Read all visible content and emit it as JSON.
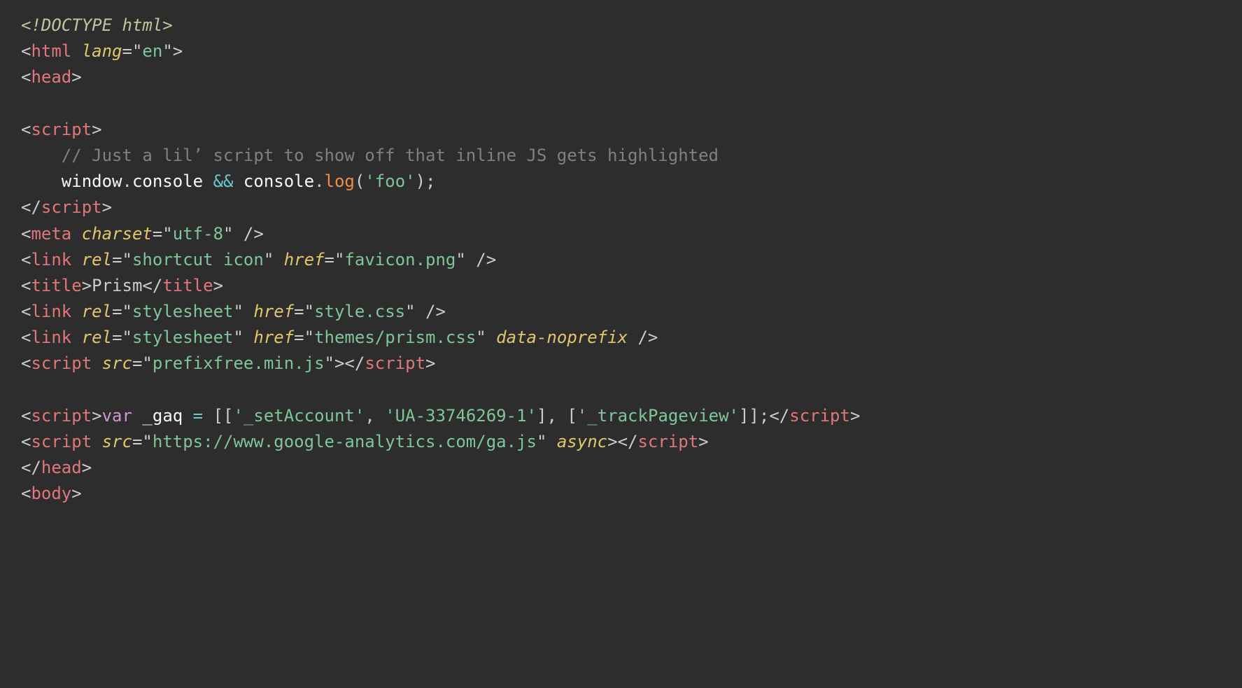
{
  "tokens": [
    [
      {
        "t": "<!DOCTYPE html>",
        "c": "doctype"
      }
    ],
    [
      {
        "t": "<",
        "c": "punct"
      },
      {
        "t": "html",
        "c": "tag"
      },
      {
        "t": " ",
        "c": "plain"
      },
      {
        "t": "lang",
        "c": "attr-name"
      },
      {
        "t": "=\"",
        "c": "punct"
      },
      {
        "t": "en",
        "c": "attr-val"
      },
      {
        "t": "\">",
        "c": "punct"
      }
    ],
    [
      {
        "t": "<",
        "c": "punct"
      },
      {
        "t": "head",
        "c": "tag"
      },
      {
        "t": ">",
        "c": "punct"
      }
    ],
    [],
    [
      {
        "t": "<",
        "c": "punct"
      },
      {
        "t": "script",
        "c": "tag"
      },
      {
        "t": ">",
        "c": "punct"
      }
    ],
    [
      {
        "t": "    ",
        "c": "plain"
      },
      {
        "t": "// Just a lil’ script to show off that inline JS gets highlighted",
        "c": "comment"
      }
    ],
    [
      {
        "t": "    ",
        "c": "plain"
      },
      {
        "t": "window",
        "c": "obj"
      },
      {
        "t": ".",
        "c": "punct"
      },
      {
        "t": "console",
        "c": "obj"
      },
      {
        "t": " ",
        "c": "plain"
      },
      {
        "t": "&&",
        "c": "operator"
      },
      {
        "t": " ",
        "c": "plain"
      },
      {
        "t": "console",
        "c": "obj"
      },
      {
        "t": ".",
        "c": "punct"
      },
      {
        "t": "log",
        "c": "func"
      },
      {
        "t": "(",
        "c": "punct"
      },
      {
        "t": "'foo'",
        "c": "string"
      },
      {
        "t": ")",
        "c": "punct"
      },
      {
        "t": ";",
        "c": "punct"
      }
    ],
    [
      {
        "t": "</",
        "c": "punct"
      },
      {
        "t": "script",
        "c": "tag"
      },
      {
        "t": ">",
        "c": "punct"
      }
    ],
    [
      {
        "t": "<",
        "c": "punct"
      },
      {
        "t": "meta",
        "c": "tag"
      },
      {
        "t": " ",
        "c": "plain"
      },
      {
        "t": "charset",
        "c": "attr-name"
      },
      {
        "t": "=\"",
        "c": "punct"
      },
      {
        "t": "utf-8",
        "c": "attr-val"
      },
      {
        "t": "\"",
        "c": "punct"
      },
      {
        "t": " />",
        "c": "punct"
      }
    ],
    [
      {
        "t": "<",
        "c": "punct"
      },
      {
        "t": "link",
        "c": "tag"
      },
      {
        "t": " ",
        "c": "plain"
      },
      {
        "t": "rel",
        "c": "attr-name"
      },
      {
        "t": "=\"",
        "c": "punct"
      },
      {
        "t": "shortcut icon",
        "c": "attr-val"
      },
      {
        "t": "\"",
        "c": "punct"
      },
      {
        "t": " ",
        "c": "plain"
      },
      {
        "t": "href",
        "c": "attr-name"
      },
      {
        "t": "=\"",
        "c": "punct"
      },
      {
        "t": "favicon.png",
        "c": "attr-val"
      },
      {
        "t": "\"",
        "c": "punct"
      },
      {
        "t": " />",
        "c": "punct"
      }
    ],
    [
      {
        "t": "<",
        "c": "punct"
      },
      {
        "t": "title",
        "c": "tag"
      },
      {
        "t": ">",
        "c": "punct"
      },
      {
        "t": "Prism",
        "c": "plain"
      },
      {
        "t": "</",
        "c": "punct"
      },
      {
        "t": "title",
        "c": "tag"
      },
      {
        "t": ">",
        "c": "punct"
      }
    ],
    [
      {
        "t": "<",
        "c": "punct"
      },
      {
        "t": "link",
        "c": "tag"
      },
      {
        "t": " ",
        "c": "plain"
      },
      {
        "t": "rel",
        "c": "attr-name"
      },
      {
        "t": "=\"",
        "c": "punct"
      },
      {
        "t": "stylesheet",
        "c": "attr-val"
      },
      {
        "t": "\"",
        "c": "punct"
      },
      {
        "t": " ",
        "c": "plain"
      },
      {
        "t": "href",
        "c": "attr-name"
      },
      {
        "t": "=\"",
        "c": "punct"
      },
      {
        "t": "style.css",
        "c": "attr-val"
      },
      {
        "t": "\"",
        "c": "punct"
      },
      {
        "t": " />",
        "c": "punct"
      }
    ],
    [
      {
        "t": "<",
        "c": "punct"
      },
      {
        "t": "link",
        "c": "tag"
      },
      {
        "t": " ",
        "c": "plain"
      },
      {
        "t": "rel",
        "c": "attr-name"
      },
      {
        "t": "=\"",
        "c": "punct"
      },
      {
        "t": "stylesheet",
        "c": "attr-val"
      },
      {
        "t": "\"",
        "c": "punct"
      },
      {
        "t": " ",
        "c": "plain"
      },
      {
        "t": "href",
        "c": "attr-name"
      },
      {
        "t": "=\"",
        "c": "punct"
      },
      {
        "t": "themes/prism.css",
        "c": "attr-val"
      },
      {
        "t": "\"",
        "c": "punct"
      },
      {
        "t": " ",
        "c": "plain"
      },
      {
        "t": "data-noprefix",
        "c": "attr-name"
      },
      {
        "t": " />",
        "c": "punct"
      }
    ],
    [
      {
        "t": "<",
        "c": "punct"
      },
      {
        "t": "script",
        "c": "tag"
      },
      {
        "t": " ",
        "c": "plain"
      },
      {
        "t": "src",
        "c": "attr-name"
      },
      {
        "t": "=\"",
        "c": "punct"
      },
      {
        "t": "prefixfree.min.js",
        "c": "attr-val"
      },
      {
        "t": "\">",
        "c": "punct"
      },
      {
        "t": "</",
        "c": "punct"
      },
      {
        "t": "script",
        "c": "tag"
      },
      {
        "t": ">",
        "c": "punct"
      }
    ],
    [],
    [
      {
        "t": "<",
        "c": "punct"
      },
      {
        "t": "script",
        "c": "tag"
      },
      {
        "t": ">",
        "c": "punct"
      },
      {
        "t": "var",
        "c": "kw-decl"
      },
      {
        "t": " ",
        "c": "plain"
      },
      {
        "t": "_gaq",
        "c": "variable"
      },
      {
        "t": " ",
        "c": "plain"
      },
      {
        "t": "=",
        "c": "operator"
      },
      {
        "t": " ",
        "c": "plain"
      },
      {
        "t": "[[",
        "c": "punct"
      },
      {
        "t": "'_setAccount'",
        "c": "string"
      },
      {
        "t": ",",
        "c": "punct"
      },
      {
        "t": " ",
        "c": "plain"
      },
      {
        "t": "'UA-33746269-1'",
        "c": "string"
      },
      {
        "t": "]",
        "c": "punct"
      },
      {
        "t": ",",
        "c": "punct"
      },
      {
        "t": " ",
        "c": "plain"
      },
      {
        "t": "[",
        "c": "punct"
      },
      {
        "t": "'_trackPageview'",
        "c": "string"
      },
      {
        "t": "]]",
        "c": "punct"
      },
      {
        "t": ";",
        "c": "punct"
      },
      {
        "t": "</",
        "c": "punct"
      },
      {
        "t": "script",
        "c": "tag"
      },
      {
        "t": ">",
        "c": "punct"
      }
    ],
    [
      {
        "t": "<",
        "c": "punct"
      },
      {
        "t": "script",
        "c": "tag"
      },
      {
        "t": " ",
        "c": "plain"
      },
      {
        "t": "src",
        "c": "attr-name"
      },
      {
        "t": "=\"",
        "c": "punct"
      },
      {
        "t": "https://www.google-analytics.com/ga.js",
        "c": "attr-val"
      },
      {
        "t": "\"",
        "c": "punct"
      },
      {
        "t": " ",
        "c": "plain"
      },
      {
        "t": "async",
        "c": "attr-name"
      },
      {
        "t": ">",
        "c": "punct"
      },
      {
        "t": "</",
        "c": "punct"
      },
      {
        "t": "script",
        "c": "tag"
      },
      {
        "t": ">",
        "c": "punct"
      }
    ],
    [
      {
        "t": "</",
        "c": "punct"
      },
      {
        "t": "head",
        "c": "tag"
      },
      {
        "t": ">",
        "c": "punct"
      }
    ],
    [
      {
        "t": "<",
        "c": "punct"
      },
      {
        "t": "body",
        "c": "tag"
      },
      {
        "t": ">",
        "c": "punct"
      }
    ]
  ]
}
